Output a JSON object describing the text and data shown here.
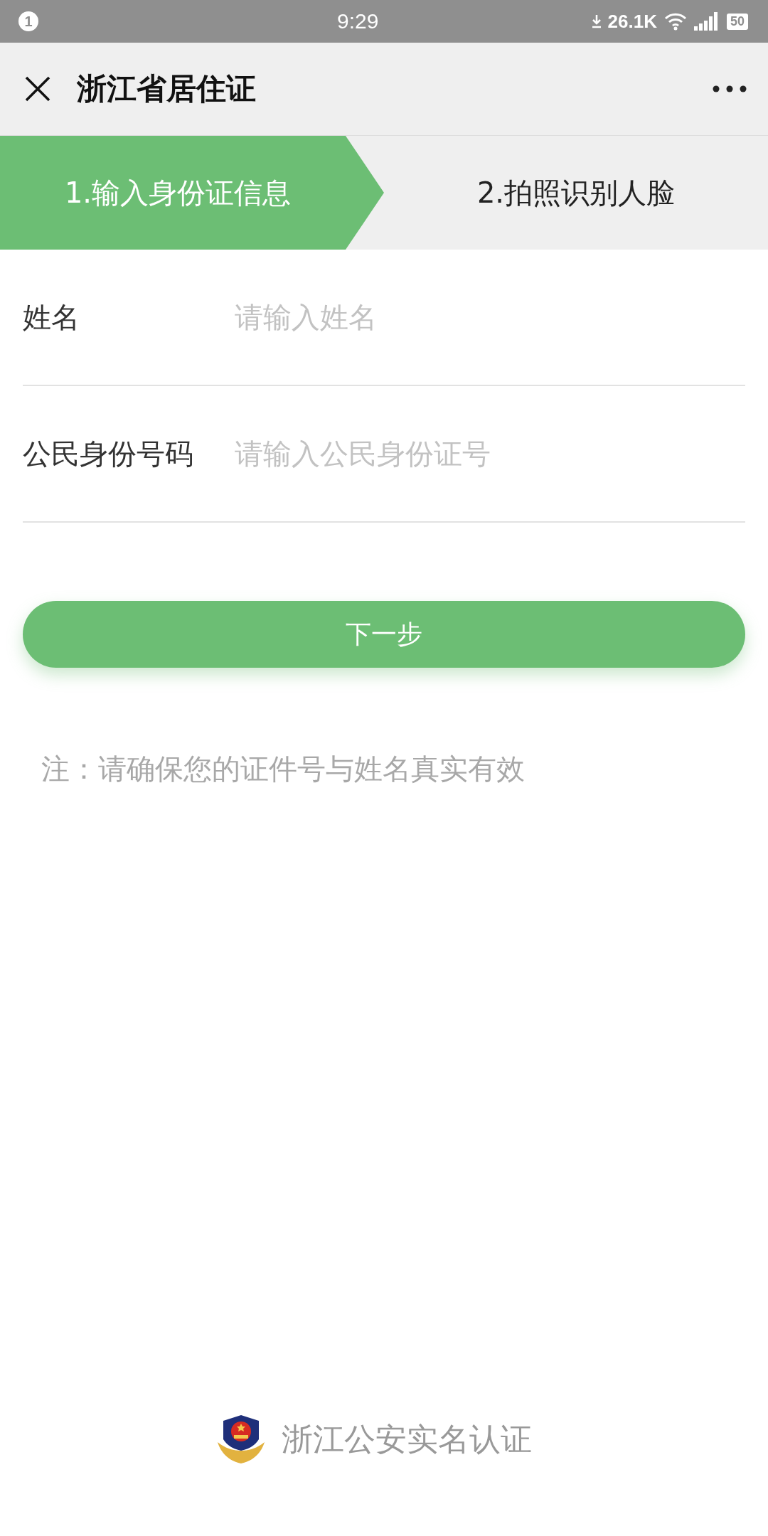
{
  "status_bar": {
    "notification_count": "1",
    "time": "9:29",
    "speed": "26.1K",
    "battery": "50"
  },
  "header": {
    "title": "浙江省居住证"
  },
  "steps": [
    {
      "label": "1.输入身份证信息",
      "selected": true
    },
    {
      "label": "2.拍照识别人脸",
      "selected": false
    }
  ],
  "fields": [
    {
      "label": "姓名",
      "placeholder": "请输入姓名"
    },
    {
      "label": "公民身份号码",
      "placeholder": "请输入公民身份证号"
    }
  ],
  "next_button": "下一步",
  "note": "注：请确保您的证件号与姓名真实有效",
  "footer": {
    "text": "浙江公安实名认证"
  }
}
